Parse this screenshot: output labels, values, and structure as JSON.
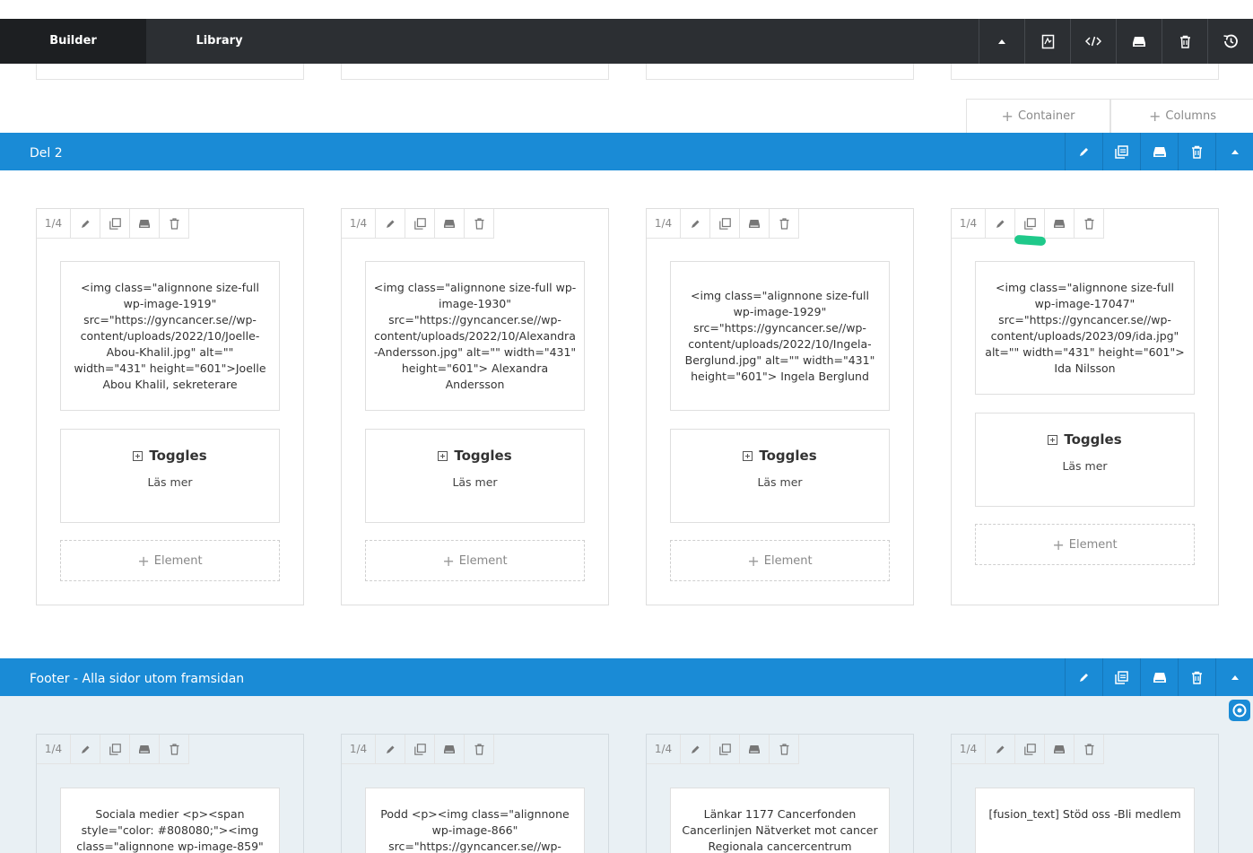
{
  "topbar": {
    "tabs": [
      {
        "label": "Builder"
      },
      {
        "label": "Library"
      }
    ],
    "tools": [
      "chevron-up-icon",
      "page-template-icon",
      "code-icon",
      "save-icon",
      "trash-icon",
      "history-icon"
    ]
  },
  "add_buttons": {
    "container": "Container",
    "columns": "Columns"
  },
  "sections": [
    {
      "title": "Del 2",
      "columns": [
        {
          "size": "1/4",
          "text": "<img class=\"alignnone size-full wp-image-1919\" src=\"https://gyncancer.se//wp-content/uploads/2022/10/Joelle-Abou-Khalil.jpg\" alt=\"\" width=\"431\" height=\"601\">Joelle Abou Khalil, sekreterare",
          "toggle_title": "Toggles",
          "toggle_sub": "Läs mer",
          "add_element": "Element"
        },
        {
          "size": "1/4",
          "text": "<img class=\"alignnone size-full wp-image-1930\" src=\"https://gyncancer.se//wp-content/uploads/2022/10/Alexandra-Andersson.jpg\" alt=\"\" width=\"431\" height=\"601\"> Alexandra Andersson",
          "toggle_title": "Toggles",
          "toggle_sub": "Läs mer",
          "add_element": "Element"
        },
        {
          "size": "1/4",
          "text": "<img class=\"alignnone size-full wp-image-1929\" src=\"https://gyncancer.se//wp-content/uploads/2022/10/Ingela-Berglund.jpg\" alt=\"\" width=\"431\" height=\"601\"> Ingela Berglund",
          "toggle_title": "Toggles",
          "toggle_sub": "Läs mer",
          "add_element": "Element"
        },
        {
          "size": "1/4",
          "text": "<img class=\"alignnone size-full wp-image-17047\" src=\"https://gyncancer.se//wp-content/uploads/2023/09/ida.jpg\" alt=\"\" width=\"431\" height=\"601\"> Ida Nilsson",
          "toggle_title": "Toggles",
          "toggle_sub": "Läs mer",
          "add_element": "Element"
        }
      ]
    },
    {
      "title": "Footer - Alla sidor utom framsidan",
      "columns": [
        {
          "size": "1/4",
          "text": "Sociala medier <p><span style=\"color: #808080;\"><img class=\"alignnone wp-image-859\""
        },
        {
          "size": "1/4",
          "text": "Podd <p><img class=\"alignnone wp-image-866\" src=\"https://gyncancer.se//wp-"
        },
        {
          "size": "1/4",
          "text": "Länkar 1177 Cancerfonden Cancerlinjen Nätverket mot cancer Regionala cancercentrum"
        },
        {
          "size": "1/4",
          "text": "[fusion_text] Stöd oss -Bli medlem"
        }
      ]
    }
  ]
}
